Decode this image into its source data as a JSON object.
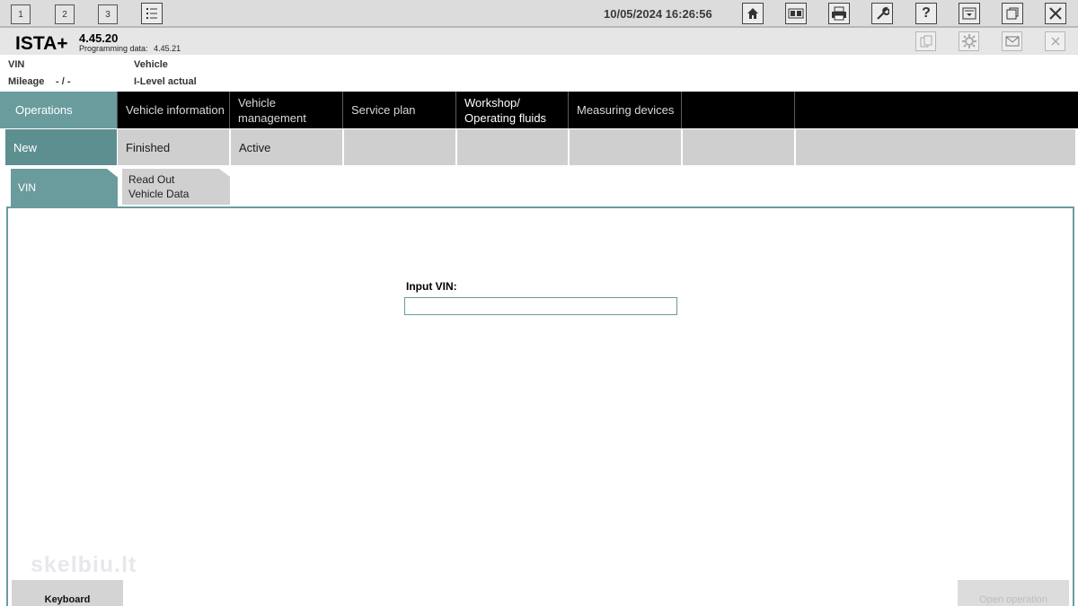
{
  "topbar": {
    "workspaces": [
      "1",
      "2",
      "3"
    ],
    "datetime": "10/05/2024 16:26:56",
    "icons": [
      "list-icon",
      "home-icon",
      "vehicle-display-icon",
      "print-icon",
      "wrench-icon",
      "help-icon",
      "minimize-icon",
      "window-icon",
      "close-icon"
    ]
  },
  "app": {
    "name": "ISTA+",
    "version": "4.45.20",
    "programming_data_label": "Programming data:",
    "programming_data_value": "4.45.21",
    "header_icons": [
      "copy-icon",
      "settings-icon",
      "mail-icon",
      "close-icon"
    ]
  },
  "info": {
    "vin_label": "VIN",
    "vehicle_label": "Vehicle",
    "mileage_label": "Mileage",
    "mileage_value": "- / -",
    "ilevel_label": "I-Level actual"
  },
  "nav": {
    "items": [
      {
        "label": "Operations"
      },
      {
        "label": "Vehicle information"
      },
      {
        "label": "Vehicle management"
      },
      {
        "label": "Service plan"
      },
      {
        "label": "Workshop/ Operating fluids"
      },
      {
        "label": "Measuring devices"
      }
    ]
  },
  "subnav": {
    "items": [
      {
        "label": "New"
      },
      {
        "label": "Finished"
      },
      {
        "label": "Active"
      }
    ]
  },
  "tabs": {
    "vin": "VIN",
    "read_out_line1": "Read Out",
    "read_out_line2": "Vehicle Data"
  },
  "form": {
    "input_vin_label": "Input VIN:",
    "input_vin_value": ""
  },
  "buttons": {
    "keyboard": "Keyboard",
    "open_operation": "Open operation"
  },
  "watermark": "skelbiu.lt",
  "colors": {
    "accent": "#6a9c9d",
    "nav_bg": "#000000",
    "tab_gray": "#cfcfcf"
  }
}
